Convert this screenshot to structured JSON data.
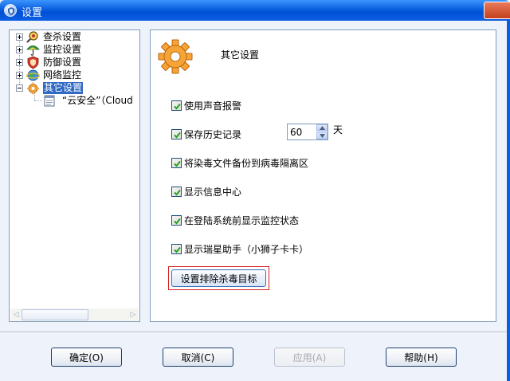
{
  "window": {
    "title": "设置"
  },
  "tree": {
    "items": [
      {
        "label": "查杀设置",
        "icon": "magnifier-virus-icon"
      },
      {
        "label": "监控设置",
        "icon": "umbrella-icon"
      },
      {
        "label": "防御设置",
        "icon": "shield-icon"
      },
      {
        "label": "网络监控",
        "icon": "globe-icon"
      },
      {
        "label": "其它设置",
        "icon": "gear-icon",
        "selected": true
      }
    ],
    "subitem": {
      "label": "“云安全”（Cloud",
      "icon": "document-icon"
    }
  },
  "content": {
    "title": "其它设置",
    "options": [
      {
        "label": "使用声音报警",
        "checked": true
      },
      {
        "label": "保存历史记录",
        "checked": true
      },
      {
        "label": "将染毒文件备份到病毒隔离区",
        "checked": true
      },
      {
        "label": "显示信息中心",
        "checked": true
      },
      {
        "label": "在登陆系统前显示监控状态",
        "checked": true
      },
      {
        "label": "显示瑞星助手（小狮子卡卡）",
        "checked": true
      }
    ],
    "history_days": "60",
    "history_unit": "天",
    "exclude_button": "设置排除杀毒目标"
  },
  "buttons": {
    "ok": "确定(O)",
    "cancel": "取消(C)",
    "apply": "应用(A)",
    "help": "帮助(H)"
  },
  "colors": {
    "accent": "#0a5fde",
    "selection": "#316ac5",
    "highlight_border": "#d42020"
  }
}
